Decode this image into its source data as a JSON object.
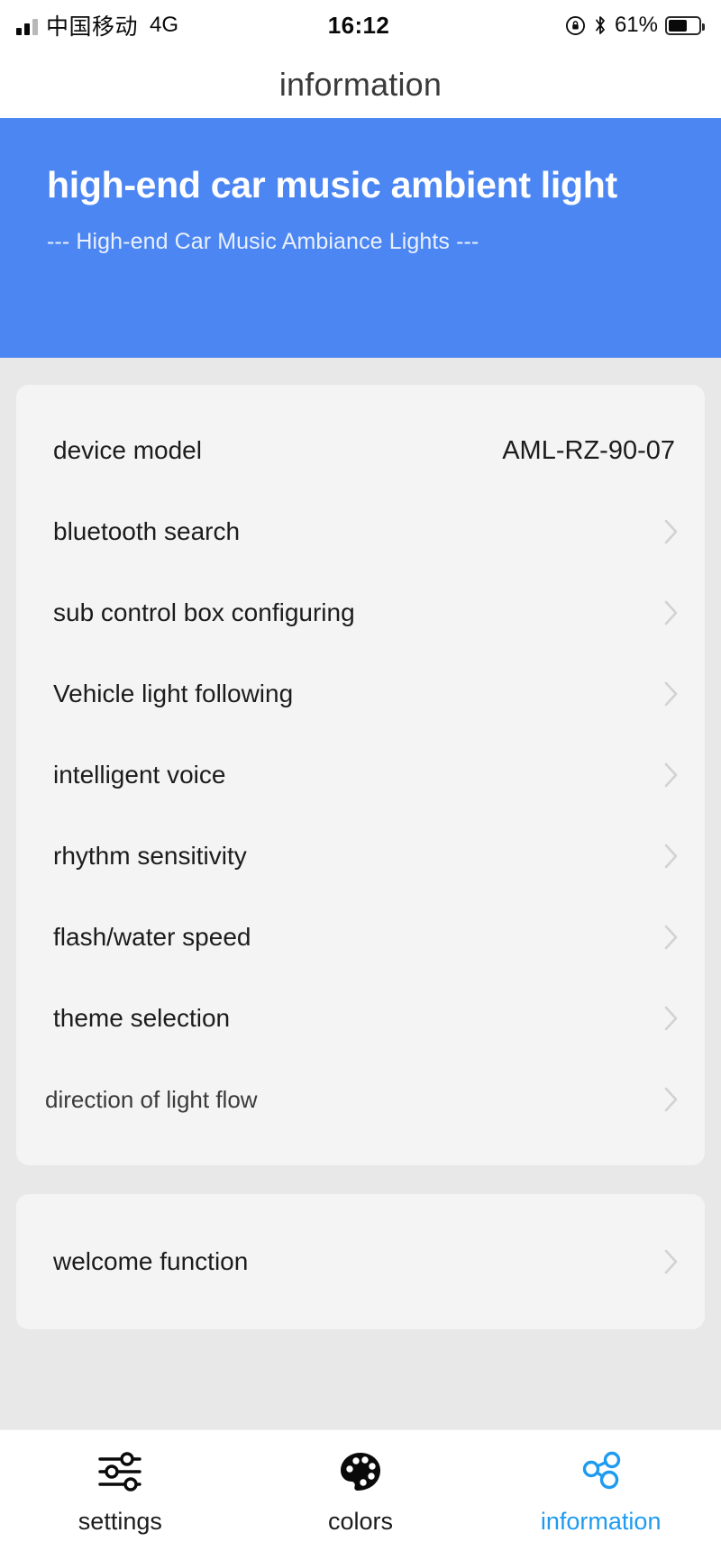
{
  "status_bar": {
    "carrier": "中国移动",
    "network": "4G",
    "time": "16:12",
    "battery_percent": "61%",
    "battery_level": 61,
    "icons": [
      "signal-bars-icon",
      "rotation-lock-icon",
      "bluetooth-icon",
      "battery-icon"
    ]
  },
  "nav": {
    "title": "information"
  },
  "hero": {
    "title": "high-end car music ambient light",
    "subtitle": "--- High-end Car Music Ambiance Lights ---",
    "background_color": "#4c86f2"
  },
  "cards": [
    {
      "name": "device-settings-card",
      "rows": [
        {
          "label": "device model",
          "value": "AML-RZ-90-07",
          "chevron": false
        },
        {
          "label": "bluetooth search",
          "value": "",
          "chevron": true
        },
        {
          "label": "sub control box configuring",
          "value": "",
          "chevron": true
        },
        {
          "label": "Vehicle light following",
          "value": "",
          "chevron": true
        },
        {
          "label": "intelligent voice",
          "value": "",
          "chevron": true
        },
        {
          "label": "rhythm sensitivity",
          "value": "",
          "chevron": true
        },
        {
          "label": "flash/water speed",
          "value": "",
          "chevron": true
        },
        {
          "label": "theme selection",
          "value": "",
          "chevron": true
        },
        {
          "label": "direction of light flow",
          "value": "",
          "chevron": true,
          "style": "small"
        }
      ]
    },
    {
      "name": "welcome-card",
      "rows": [
        {
          "label": "welcome function",
          "value": "",
          "chevron": true
        }
      ]
    }
  ],
  "tab_bar": {
    "active": "information",
    "accent_color": "#1e9bf0",
    "tabs": [
      {
        "label": "settings",
        "icon": "sliders-icon"
      },
      {
        "label": "colors",
        "icon": "palette-icon"
      },
      {
        "label": "information",
        "icon": "share-nodes-icon"
      }
    ]
  }
}
